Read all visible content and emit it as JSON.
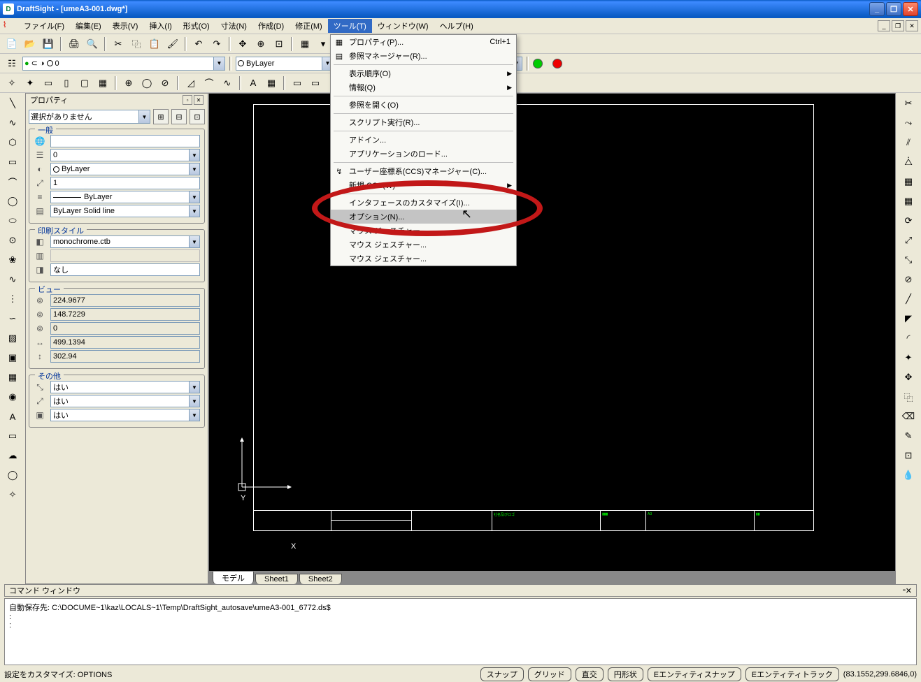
{
  "title": "DraftSight - [umeA3-001.dwg*]",
  "menubar": [
    "ファイル(F)",
    "編集(E)",
    "表示(V)",
    "挿入(I)",
    "形式(O)",
    "寸法(N)",
    "作成(D)",
    "修正(M)",
    "ツール(T)",
    "ウィンドウ(W)",
    "ヘルプ(H)"
  ],
  "layer_combo": "0",
  "bylayer_combo": "ByLayer",
  "panel_title": "プロパティ",
  "sel_combo": "選択がありません",
  "groups": {
    "general": "一般",
    "print": "印刷スタイル",
    "view": "ビュー",
    "other": "その他"
  },
  "props": {
    "gen_url": "",
    "gen_layer": "0",
    "gen_color": "ByLayer",
    "gen_scale": "1",
    "gen_ltype": "———— ByLayer",
    "gen_lweight": "ByLayer   Solid line",
    "print_ctb": "monochrome.ctb",
    "print_none": "なし",
    "view_x": "224.9677",
    "view_y": "148.7229",
    "view_z": "0",
    "view_w": "499.1394",
    "view_h": "302.94",
    "other_1": "はい",
    "other_2": "はい",
    "other_3": "はい"
  },
  "sheets": [
    "モデル",
    "Sheet1",
    "Sheet2"
  ],
  "cmdwin_title": "コマンド ウィンドウ",
  "cmdline": "自動保存先: C:\\DOCUME~1\\kaz\\LOCALS~1\\Temp\\DraftSight_autosave\\umeA3-001_6772.ds$",
  "cmdprompt": ":",
  "status_left": "設定をカスタマイズ: OPTIONS",
  "status_btns": [
    "スナップ",
    "グリッド",
    "直交",
    "円形状",
    "Eエンティティスナップ",
    "Eエンティティトラック"
  ],
  "coords": "(83.1552,299.6846,0)",
  "menu": {
    "properties": "プロパティ(P)...",
    "properties_short": "Ctrl+1",
    "refmgr": "参照マネージャー(R)...",
    "disporder": "表示順序(O)",
    "info": "情報(Q)",
    "openref": "参照を開く(O)",
    "script": "スクリプト実行(R)...",
    "addin": "アドイン...",
    "appload": "アプリケーションのロード...",
    "ccsmgr": "ユーザー座標系(CCS)マネージャー(C)...",
    "newccs": "新規 CCS(W)",
    "customize": "インタフェースのカスタマイズ(I)...",
    "options": "オプション(N)...",
    "mouse1": "マウス ジェスチャー...",
    "mouse2": "マウス ジェスチャー...",
    "mouse3": "マウス ジェスチャー..."
  }
}
